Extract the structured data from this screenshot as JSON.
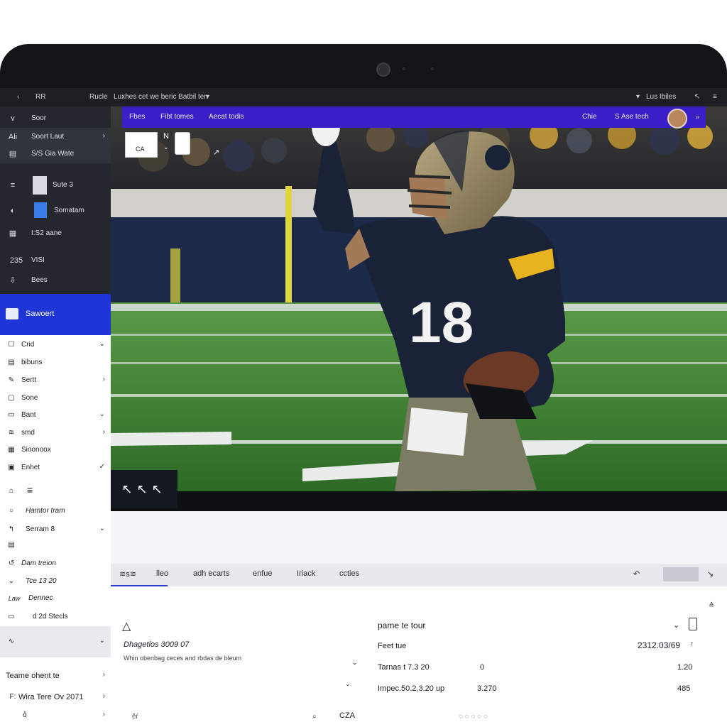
{
  "window": {
    "back": "‹",
    "breadcrumb_short": "RR",
    "breadcrumb_main": "Rucle",
    "title": "Luxhes cet we beric Batbil ten",
    "right_label": "Lus Ibiles"
  },
  "sidebar_dark": [
    {
      "icon": "v",
      "label": "Soor",
      "chevron": ""
    },
    {
      "icon": "Ali",
      "label": "Soort Laut",
      "chevron": "›"
    },
    {
      "icon": "▤",
      "label": "S/S Gia Wate",
      "chevron": ""
    },
    {
      "icon": "≡",
      "label": "Sute 3",
      "chevron": ""
    },
    {
      "icon": "◐",
      "label": "Somatam",
      "chevron": ""
    },
    {
      "icon": "▦",
      "label": "I:S2 aane",
      "chevron": ""
    },
    {
      "icon": "235",
      "label": "VISI",
      "chevron": ""
    },
    {
      "icon": "⇩",
      "label": "Bees",
      "chevron": ""
    }
  ],
  "sidebar_active": {
    "label": "Sawoert"
  },
  "sidebar_light": [
    {
      "icon": "☐",
      "label": "Crid",
      "chevron": "⌄"
    },
    {
      "icon": "▤",
      "label": "bibuns",
      "chevron": ""
    },
    {
      "icon": "✎",
      "label": "Sertt",
      "chevron": "›"
    },
    {
      "icon": "▢",
      "label": "Sone",
      "chevron": ""
    },
    {
      "icon": "▭",
      "label": "Bant",
      "chevron": "⌄"
    },
    {
      "icon": "≋",
      "label": "smd",
      "chevron": "›"
    },
    {
      "icon": "▦",
      "label": "Sioonoox",
      "chevron": ""
    },
    {
      "icon": "▣",
      "label": "Enhet",
      "chevron": "✓"
    },
    {
      "icon": "⌂",
      "label": "≡",
      "chevron": ""
    },
    {
      "icon": "○",
      "label": "Hamtor tram",
      "chevron": ""
    },
    {
      "icon": "↰",
      "label": "Serram 8",
      "chevron": "⌄"
    },
    {
      "icon": "▤",
      "label": "",
      "chevron": ""
    },
    {
      "icon": "↺",
      "label": "Dam treion",
      "chevron": ""
    },
    {
      "icon": "⌄",
      "label": "Tce 13 20",
      "chevron": ""
    },
    {
      "icon": "Law",
      "label": "Dennec",
      "chevron": ""
    },
    {
      "icon": "▭",
      "label": "d 2d Stecls",
      "chevron": ""
    },
    {
      "icon": "∿",
      "label": "",
      "chevron": "⌄"
    },
    {
      "icon": "",
      "label": "Teame ohent te",
      "chevron": "›"
    },
    {
      "icon": "F:",
      "label": "Wira Tere Ov 2071",
      "chevron": "›"
    },
    {
      "icon": "",
      "label": "ỏ",
      "chevron": "›"
    }
  ],
  "photo_nav": {
    "item1": "Fbes",
    "item2": "Fibt tomes",
    "item3": "Aecat todis",
    "item4": "Chie",
    "item5": "S Ase tech"
  },
  "photo_overlay": {
    "card_text": "CA",
    "card2_text": "N",
    "corner_badge": "↖↖↖"
  },
  "player": {
    "jersey_number": "18"
  },
  "tabs": [
    "≋s≋",
    "lleo",
    "adh ecarts",
    "enfue",
    "Iriack",
    "ccties"
  ],
  "panel": {
    "title": "pame te tour",
    "left_heading": "Dhagetios 3009 07",
    "left_sub": "Whin obenbag ceces and rbdas de bleum",
    "row1_label": "Feet tue",
    "row1_value": "2312.03/69",
    "row2_label": "Tarnas t 7.3 20",
    "row2_mid": "0",
    "row2_value": "1.20",
    "row3_label": "Impec.50.2,3.20 up",
    "row3_mid": "3.270",
    "row3_value": "485",
    "footer_left": "ĕŕ",
    "footer_mid": "CZA",
    "footer_right": "◌ ◌ ◌ ◌ ◌"
  },
  "colors": {
    "sidebar_dark": "#24272d",
    "accent_blue": "#1f35d8",
    "photo_nav_purple": "#3a1ec6",
    "jersey_navy": "#1a2238",
    "helmet_gold": "#8e7f5b",
    "field_green": "#3e7f33"
  }
}
